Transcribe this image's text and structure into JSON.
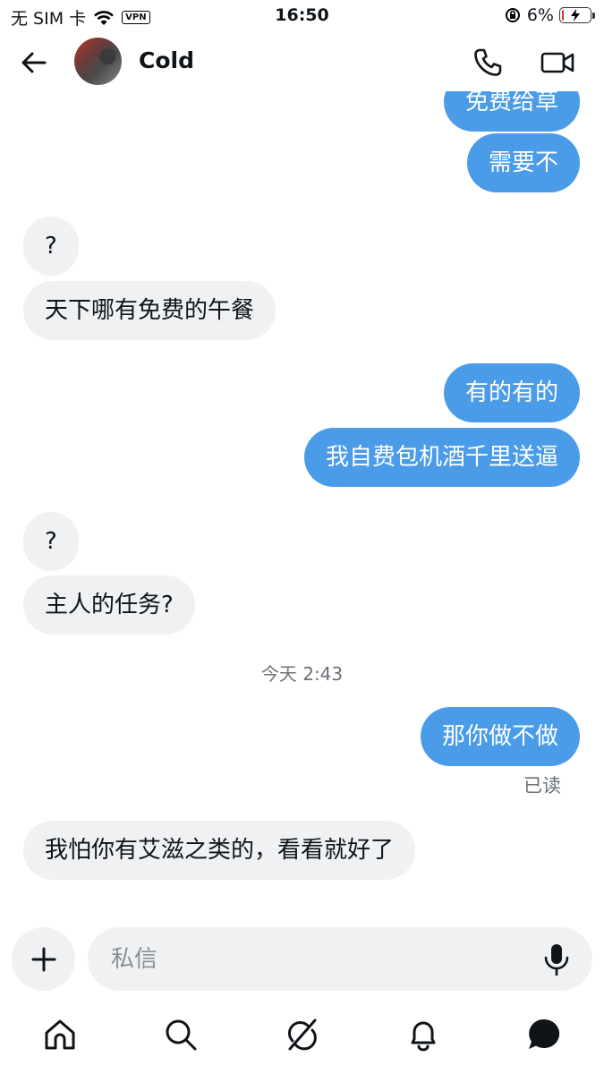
{
  "status_bar": {
    "carrier": "无 SIM 卡",
    "vpn": "VPN",
    "time": "16:50",
    "battery": "6%",
    "battery_level": 0.06,
    "battery_color": "#e0342e"
  },
  "header": {
    "contact_name": "Cold",
    "icons": [
      "back-arrow-icon",
      "phone-icon",
      "video-icon"
    ]
  },
  "messages": [
    {
      "direction": "out",
      "text": "免费给草"
    },
    {
      "direction": "out",
      "text": "需要不"
    },
    {
      "direction": "in",
      "text": "?"
    },
    {
      "direction": "in",
      "text": "天下哪有免费的午餐"
    },
    {
      "direction": "out",
      "text": "有的有的"
    },
    {
      "direction": "out",
      "text": "我自费包机酒千里送逼"
    },
    {
      "direction": "in",
      "text": "?"
    },
    {
      "direction": "in",
      "text": "主人的任务?"
    },
    {
      "direction": "out",
      "text": "那你做不做"
    },
    {
      "direction": "in",
      "text": "我怕你有艾滋之类的，看看就好了"
    }
  ],
  "time_separator": "今天 2:43",
  "read_receipt": "已读",
  "composer": {
    "placeholder": "私信",
    "value": ""
  },
  "colors": {
    "outgoing_bubble": "#4a9be8",
    "incoming_bubble": "#eff1f3"
  },
  "bottom_nav": [
    "home-icon",
    "search-icon",
    "grok-icon",
    "notifications-icon",
    "messages-icon"
  ]
}
